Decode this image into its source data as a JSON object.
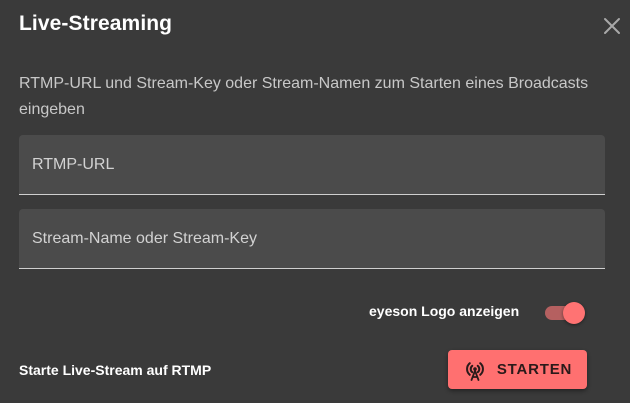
{
  "dialog": {
    "title": "Live-Streaming",
    "close_icon": "close-icon",
    "description": "RTMP-URL und Stream-Key oder Stream-Namen zum Starten eines Broadcasts eingeben"
  },
  "fields": {
    "rtmp_url": {
      "placeholder": "RTMP-URL",
      "value": ""
    },
    "stream_key": {
      "placeholder": "Stream-Name oder Stream-Key",
      "value": ""
    }
  },
  "logo_toggle": {
    "label": "eyeson Logo anzeigen",
    "checked": true,
    "accent_color": "#ff7373"
  },
  "footer": {
    "text": "Starte Live-Stream auf RTMP",
    "start_button": {
      "label": "STARTEN",
      "icon": "broadcast-tower-icon",
      "color": "#ff7070"
    }
  },
  "colors": {
    "background": "#3a3a3a",
    "field_background": "#4b4b4b"
  }
}
